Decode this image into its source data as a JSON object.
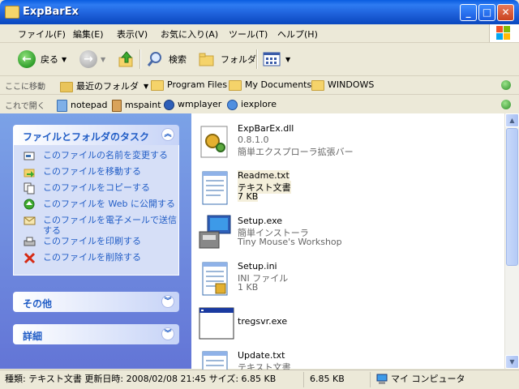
{
  "window": {
    "title": "ExpBarEx"
  },
  "caption_buttons": {
    "minimize": "_",
    "maximize": "□",
    "close": "✕"
  },
  "menu": [
    "ファイル(F)",
    "編集(E)",
    "表示(V)",
    "お気に入り(A)",
    "ツール(T)",
    "ヘルプ(H)"
  ],
  "toolbar": {
    "back_label": "戻る",
    "search_label": "検索",
    "folders_label": "フォルダ"
  },
  "address_bar": {
    "label": "ここに移動",
    "items": [
      "最近のフォルダ",
      "Program Files",
      "My Documents",
      "WINDOWS"
    ]
  },
  "open_bar": {
    "label": "これで開く",
    "items": [
      "notepad",
      "mspaint",
      "wmplayer",
      "iexplore"
    ]
  },
  "task_pane": {
    "file_tasks": {
      "title": "ファイルとフォルダのタスク",
      "items": [
        {
          "label": "このファイルの名前を変更する",
          "icon": "rename-icon"
        },
        {
          "label": "このファイルを移動する",
          "icon": "move-icon"
        },
        {
          "label": "このファイルをコピーする",
          "icon": "copy-icon"
        },
        {
          "label": "このファイルを Web に公開する",
          "icon": "web-publish-icon"
        },
        {
          "label": "このファイルを電子メールで送信する",
          "icon": "email-icon"
        },
        {
          "label": "このファイルを印刷する",
          "icon": "print-icon"
        },
        {
          "label": "このファイルを削除する",
          "icon": "delete-icon"
        }
      ]
    },
    "other_title": "その他",
    "details_title": "詳細"
  },
  "files": [
    {
      "name": "ExpBarEx.dll",
      "sub1": "0.8.1.0",
      "sub2": "簡単エクスプローラ拡張バー",
      "icon": "dll-icon"
    },
    {
      "name": "Readme.txt",
      "sub1": "テキスト文書",
      "sub2": "7 KB",
      "icon": "text-file-icon",
      "selected": true
    },
    {
      "name": "Setup.exe",
      "sub1": "簡単インストーラ",
      "sub2": "Tiny Mouse's Workshop",
      "icon": "installer-icon"
    },
    {
      "name": "Setup.ini",
      "sub1": "INI ファイル",
      "sub2": "1 KB",
      "icon": "ini-file-icon"
    },
    {
      "name": "tregsvr.exe",
      "sub1": "",
      "sub2": "",
      "icon": "exe-window-icon"
    },
    {
      "name": "Update.txt",
      "sub1": "テキスト文書",
      "sub2": "",
      "icon": "text-file-icon"
    }
  ],
  "status_bar": {
    "info": "種類: テキスト文書 更新日時: 2008/02/08 21:45 サイズ: 6.85 KB",
    "size": "6.85 KB",
    "location": "マイ コンピュータ"
  },
  "colors": {
    "accent": "#215DC6",
    "title_bar": "#0A5CE0",
    "pane": "#6375D6"
  }
}
